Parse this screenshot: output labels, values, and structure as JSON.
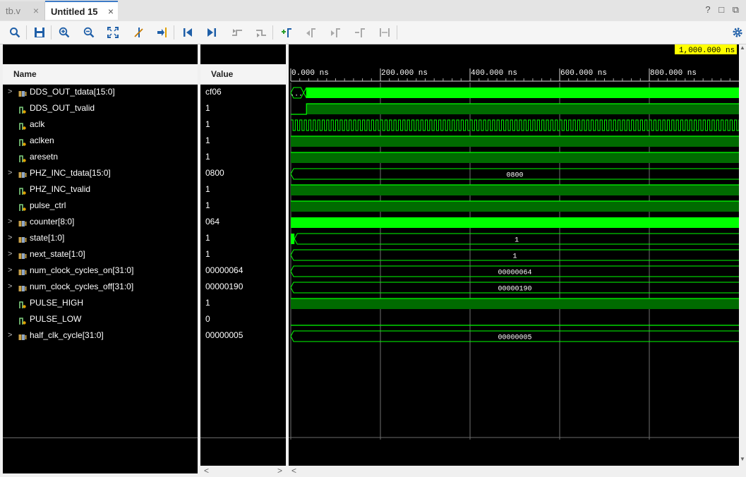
{
  "tabs": [
    {
      "label": "tb.v",
      "close": "×",
      "active": false
    },
    {
      "label": "Untitled 15",
      "close": "×",
      "active": true
    }
  ],
  "window_controls": {
    "help": "?",
    "restore": "□",
    "float": "⧉"
  },
  "toolbar_icons": [
    "search-icon",
    "save-icon",
    "zoom-in-icon",
    "zoom-out-icon",
    "zoom-fit-icon",
    "cursor-to-zero-icon",
    "go-to-time-zero-icon",
    "go-to-first-icon",
    "go-to-last-icon",
    "add-marker-icon",
    "prev-transition-icon",
    "next-transition-icon",
    "add-marker-2-icon",
    "prev-marker-icon",
    "next-marker-icon",
    "swap-cursor-icon",
    "snap-icon",
    "settings-icon"
  ],
  "columns": {
    "name": "Name",
    "value": "Value"
  },
  "cursor_time": "1,000.000 ns",
  "time_ticks": [
    "0.000 ns",
    "200.000 ns",
    "400.000 ns",
    "600.000 ns",
    "800.000 ns"
  ],
  "time_range_ns": [
    0,
    1000
  ],
  "colors": {
    "wave_bright": "#00ff00",
    "wave_dark": "#006b00",
    "grid": "#707070",
    "cursor": "#ffff00",
    "background": "#000000"
  },
  "signals": [
    {
      "name": "DDS_OUT_tdata[15:0]",
      "value": "cf06",
      "bus": true,
      "expand": true,
      "wave": "bus-solid-after",
      "text": "...",
      "change_ns": 35
    },
    {
      "name": "DDS_OUT_tvalid",
      "value": "1",
      "bus": false,
      "expand": false,
      "wave": "step-high",
      "change_ns": 35
    },
    {
      "name": "aclk",
      "value": "1",
      "bus": false,
      "expand": false,
      "wave": "clock",
      "period_ns": 10
    },
    {
      "name": "aclken",
      "value": "1",
      "bus": false,
      "expand": false,
      "wave": "high"
    },
    {
      "name": "aresetn",
      "value": "1",
      "bus": false,
      "expand": false,
      "wave": "high"
    },
    {
      "name": "PHZ_INC_tdata[15:0]",
      "value": "0800",
      "bus": true,
      "expand": true,
      "wave": "bus-const",
      "text": "0800"
    },
    {
      "name": "PHZ_INC_tvalid",
      "value": "1",
      "bus": false,
      "expand": false,
      "wave": "high"
    },
    {
      "name": "pulse_ctrl",
      "value": "1",
      "bus": false,
      "expand": false,
      "wave": "high"
    },
    {
      "name": "counter[8:0]",
      "value": "064",
      "bus": true,
      "expand": true,
      "wave": "bus-solid",
      "text": ""
    },
    {
      "name": "state[1:0]",
      "value": "1",
      "bus": true,
      "expand": true,
      "wave": "bus-after-short",
      "text": "1",
      "change_ns": 5
    },
    {
      "name": "next_state[1:0]",
      "value": "1",
      "bus": true,
      "expand": true,
      "wave": "bus-const",
      "text": "1"
    },
    {
      "name": "num_clock_cycles_on[31:0]",
      "value": "00000064",
      "bus": true,
      "expand": true,
      "wave": "bus-const",
      "text": "00000064"
    },
    {
      "name": "num_clock_cycles_off[31:0]",
      "value": "00000190",
      "bus": true,
      "expand": true,
      "wave": "bus-const",
      "text": "00000190"
    },
    {
      "name": "PULSE_HIGH",
      "value": "1",
      "bus": false,
      "expand": false,
      "wave": "high"
    },
    {
      "name": "PULSE_LOW",
      "value": "0",
      "bus": false,
      "expand": false,
      "wave": "low"
    },
    {
      "name": "half_clk_cycle[31:0]",
      "value": "00000005",
      "bus": true,
      "expand": true,
      "wave": "bus-const",
      "text": "00000005"
    }
  ],
  "scroll": {
    "left": "<",
    "right": ">",
    "up": "▲",
    "down": "▼"
  }
}
